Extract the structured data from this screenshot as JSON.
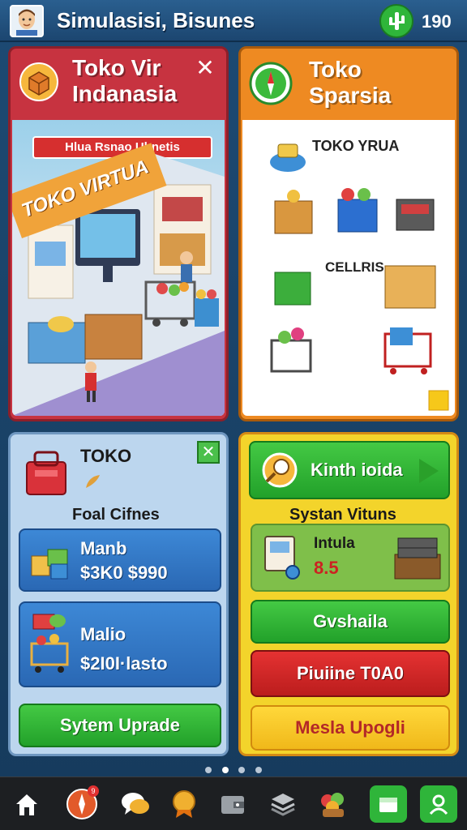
{
  "header": {
    "title": "Simulasisi, Bisunes",
    "coin_count": "190",
    "avatar_icon": "user-avatar-icon",
    "coin_icon": "cactus-coin-icon"
  },
  "cards": {
    "toko_virtual": {
      "title_line1": "Toko Vir",
      "title_line2": "Indanasia",
      "banner": "Hlua Rsnao Ubnetis",
      "store_sign": "TOKO VIRTUA",
      "accent": "#c73340"
    },
    "toko_sparsia": {
      "title_line1": "Toko",
      "title_line2": "Sparsia",
      "label_top": "TOKO YRUA",
      "label_mid": "CELLRIS",
      "accent": "#ee8a22"
    },
    "toko_panel": {
      "title": "TOKO",
      "subtitle": "Foal Cifnes",
      "rows": [
        {
          "line1": "Manb",
          "line2": "$3K0 $990"
        },
        {
          "line1": "Malio",
          "line2": "$2I0I·lasto"
        }
      ],
      "upgrade_button": "Sytem Uprade"
    },
    "sistem_panel": {
      "top_button": "Kinth ioida",
      "subtitle": "Systan Vituns",
      "panel_title": "Intula",
      "panel_value": "8.5",
      "btn_green": "Gvshaila",
      "btn_red": "Piuiine T0A0",
      "btn_yellow": "Mesla Upogli"
    }
  },
  "pager": {
    "count": 4,
    "active": 0
  },
  "bottom_nav": {
    "items": [
      {
        "icon": "home-icon"
      },
      {
        "icon": "compass-icon",
        "badge": "9"
      },
      {
        "icon": "chat-icon"
      },
      {
        "icon": "badge-icon"
      },
      {
        "icon": "wallet-icon"
      },
      {
        "icon": "stack-icon"
      },
      {
        "icon": "fruit-basket-icon"
      },
      {
        "icon": "store-icon"
      },
      {
        "icon": "profile-icon"
      }
    ]
  }
}
